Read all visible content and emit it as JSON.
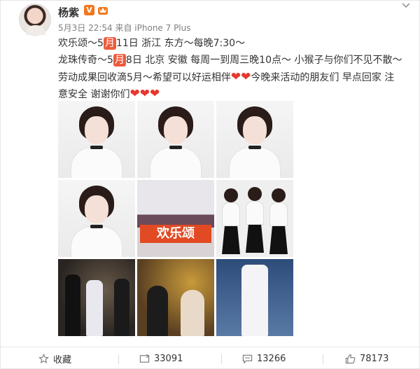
{
  "post": {
    "username": "杨紫",
    "verified_badge": "V",
    "meta": "5月3日 22:54 来自 iPhone 7 Plus",
    "line1": [
      "欢乐颂～5",
      "月",
      "11日 浙江 东方～每晚7:30～"
    ],
    "line2": [
      "龙珠传奇～5",
      "月",
      "8日 北京 安徽 每周一到周三晚10点～ 小猴子与你们不见不散～"
    ],
    "line3_a": "劳动成果回收滴5月～希望可以好运相伴",
    "line3_b": "今晚来活动的朋友们 早点回家 注",
    "line4": "意安全 谢谢你们",
    "heart": "❤",
    "event_banner": "欢乐颂"
  },
  "actions": {
    "favorite": "收藏",
    "repost": "33091",
    "comment": "13266",
    "like": "78173"
  },
  "colors": {
    "month_badge": "#f05a3c",
    "heart": "#e5392e",
    "vip_badge": "#f3761b"
  },
  "icons": [
    "star-icon",
    "repost-icon",
    "comment-icon",
    "thumbs-up-icon",
    "more-chevron-icon"
  ]
}
